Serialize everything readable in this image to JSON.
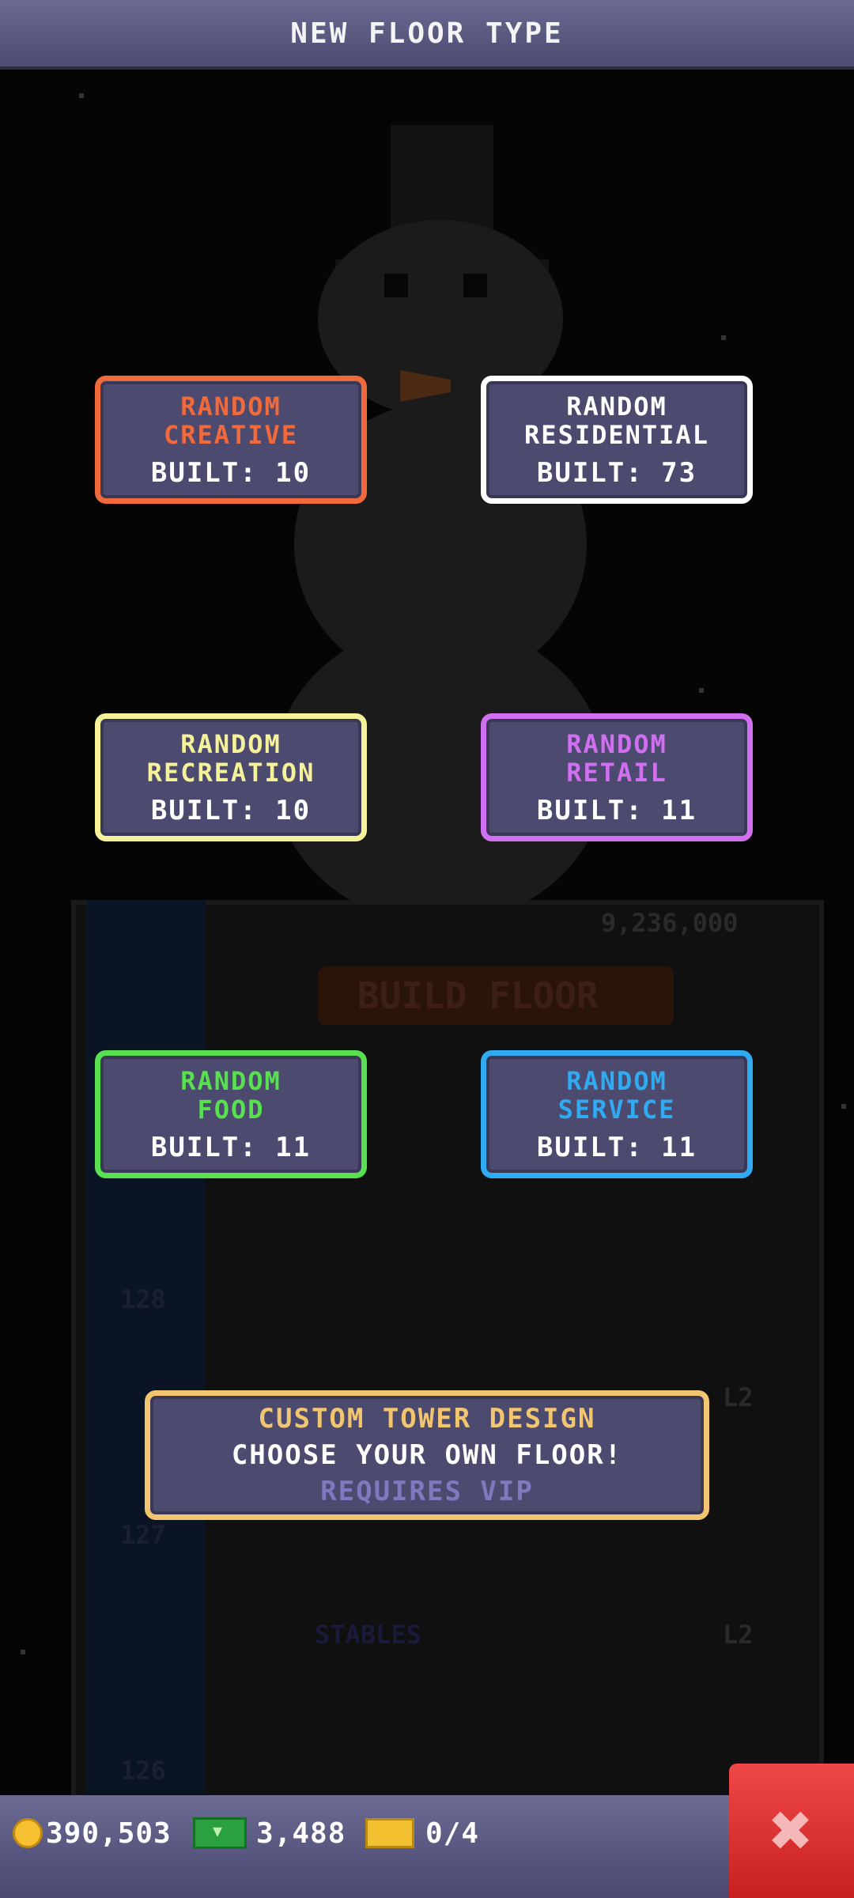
{
  "header": {
    "title": "NEW FLOOR TYPE"
  },
  "options": [
    {
      "line1": "RANDOM",
      "line2": "CREATIVE",
      "built": "BUILT: 10"
    },
    {
      "line1": "RANDOM",
      "line2": "RESIDENTIAL",
      "built": "BUILT: 73"
    },
    {
      "line1": "RANDOM",
      "line2": "RECREATION",
      "built": "BUILT: 10"
    },
    {
      "line1": "RANDOM",
      "line2": "RETAIL",
      "built": "BUILT: 11"
    },
    {
      "line1": "RANDOM",
      "line2": "FOOD",
      "built": "BUILT: 11"
    },
    {
      "line1": "RANDOM",
      "line2": "SERVICE",
      "built": "BUILT: 11"
    }
  ],
  "custom": {
    "title": "CUSTOM TOWER DESIGN",
    "subtitle": "CHOOSE YOUR OWN FLOOR!",
    "requirement": "REQUIRES VIP"
  },
  "footer": {
    "coins": "390,503",
    "bux": "3,488",
    "tickets": "0/4",
    "close_icon": "close-icon"
  },
  "background": {
    "build_floor": "BUILD FLOOR",
    "price": "9,236,000",
    "floor_128": "128",
    "floor_127": "127",
    "floor_126": "126",
    "stables": "STABLES",
    "level": "L2"
  },
  "colors": {
    "creative": "#f06a3c",
    "residential": "#ffffff",
    "recreation": "#f6f29a",
    "retail": "#d070f0",
    "food": "#58e050",
    "service": "#30aaf0",
    "custom": "#f2c570",
    "close": "#e03030"
  }
}
